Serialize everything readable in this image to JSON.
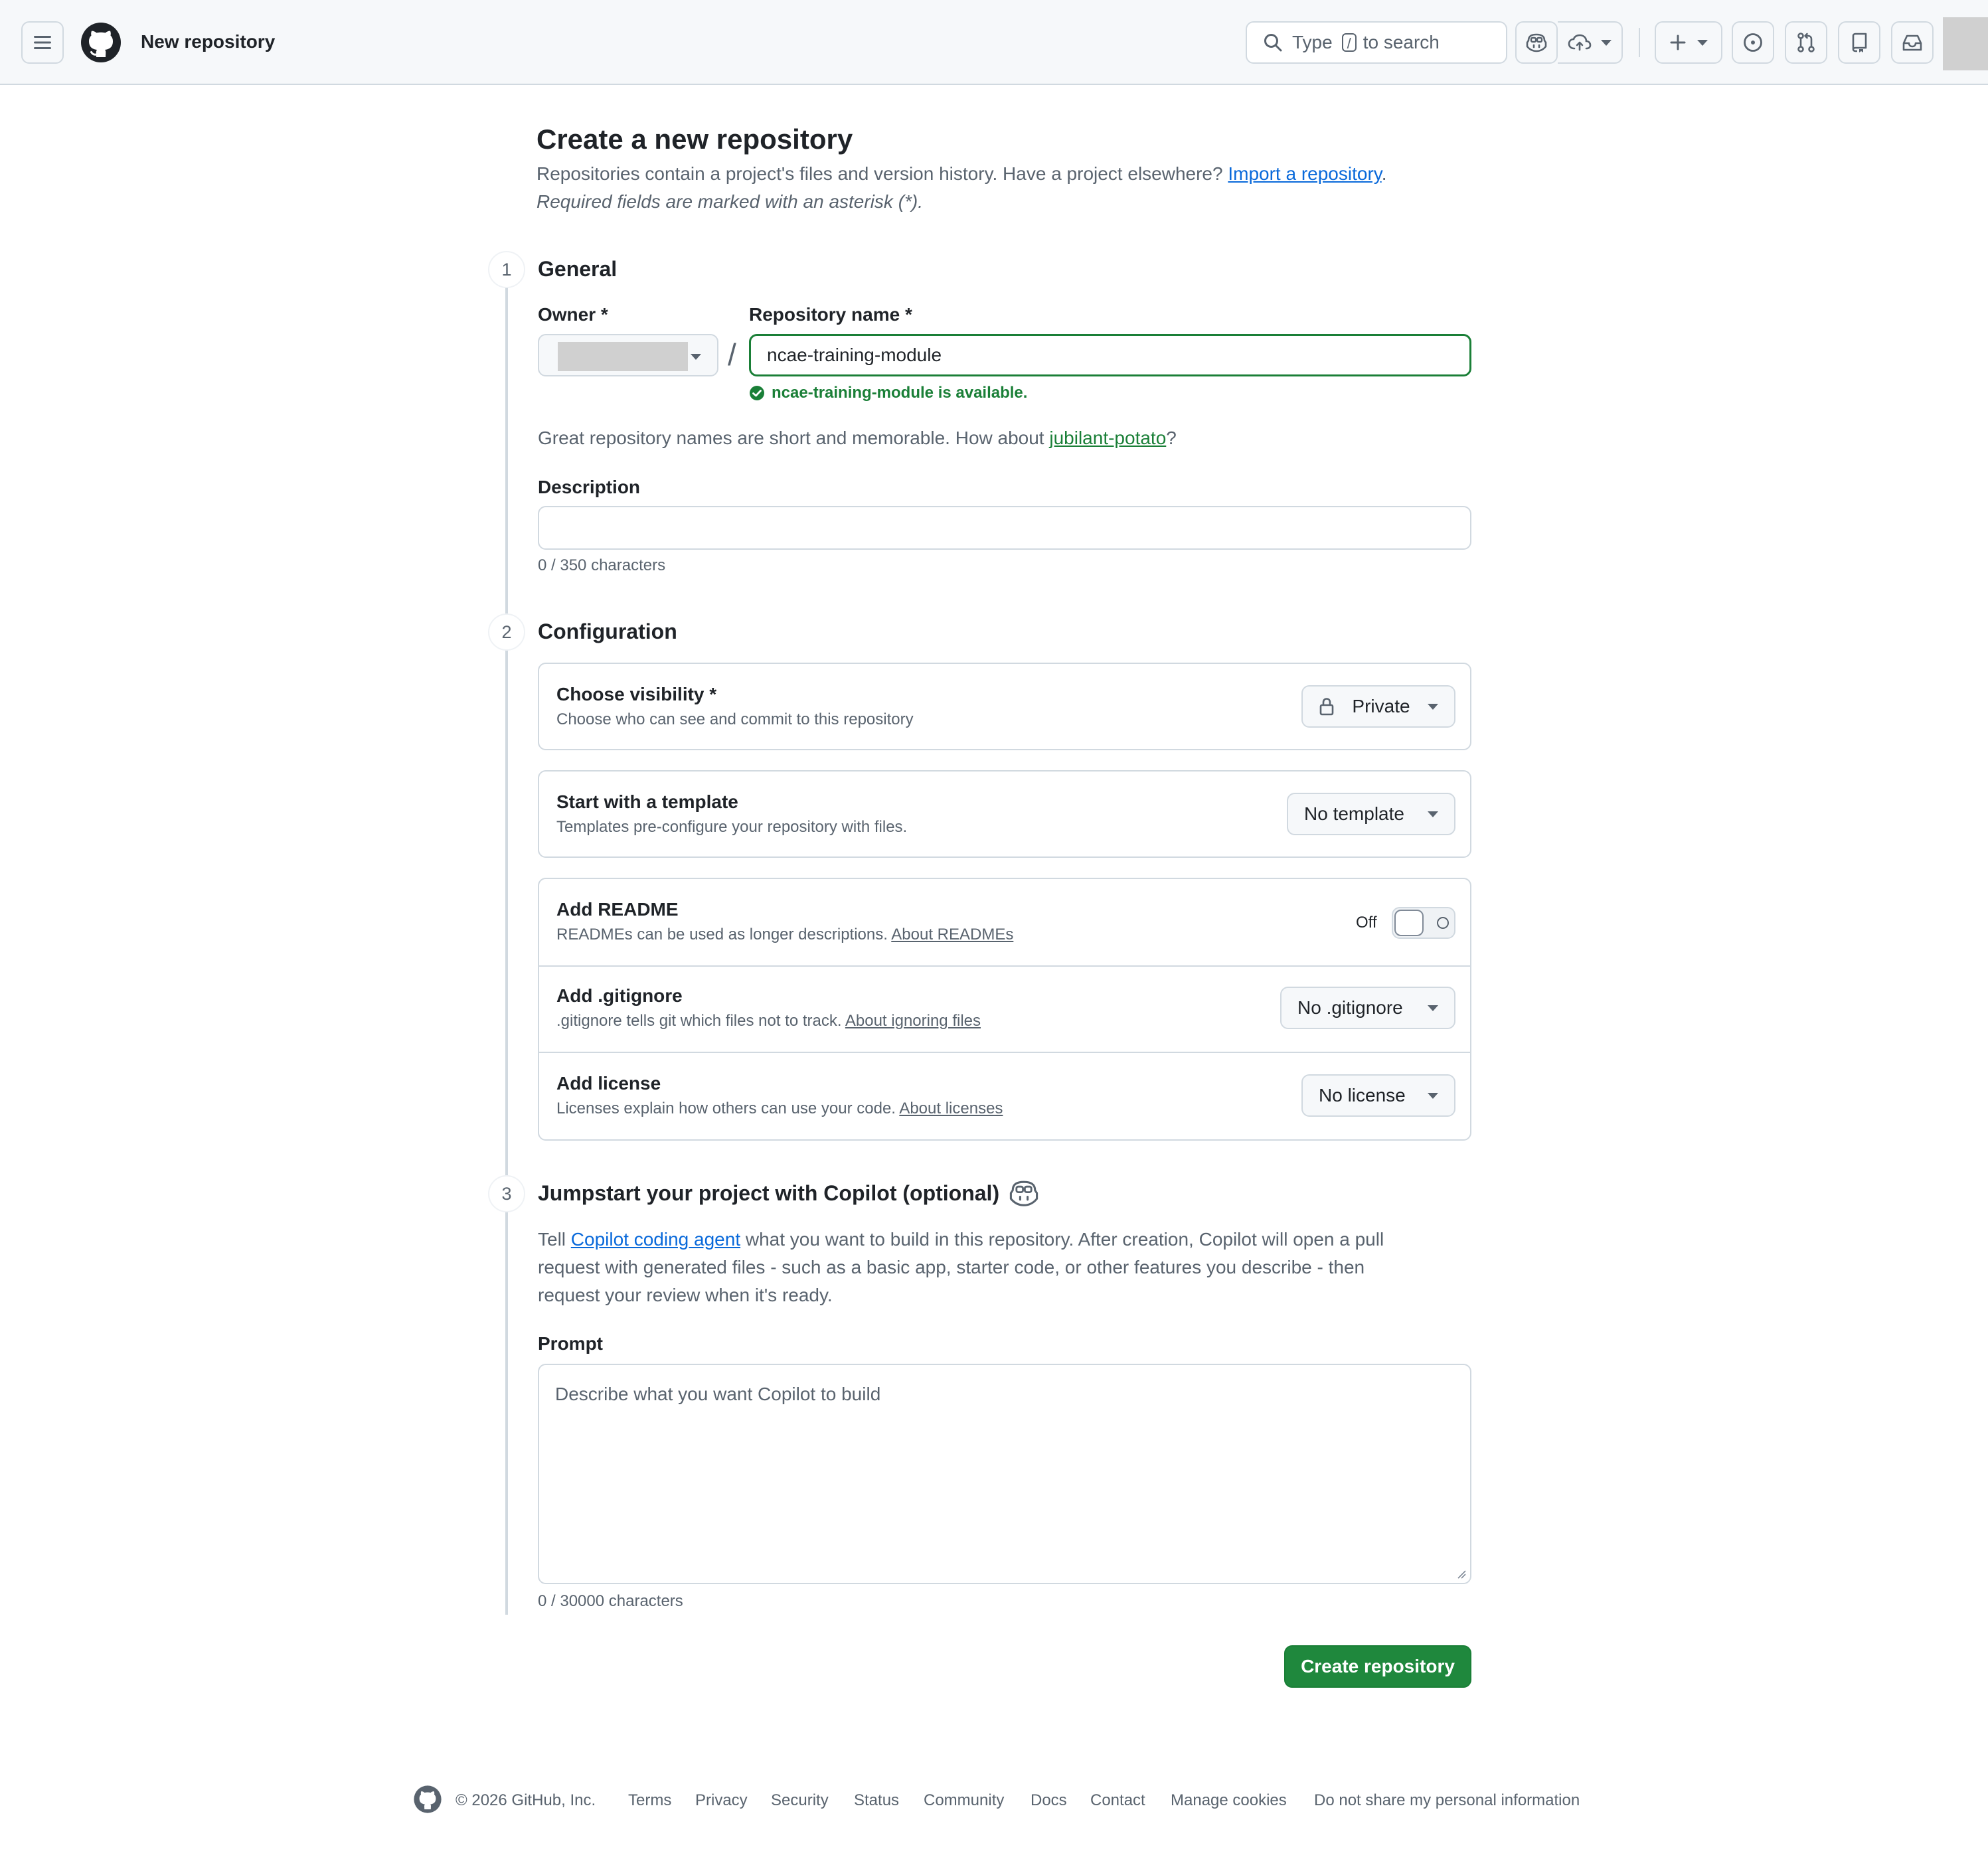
{
  "header": {
    "title": "New repository",
    "search": {
      "prefix": "Type",
      "key": "/",
      "suffix": "to search"
    }
  },
  "page": {
    "heading": "Create a new repository",
    "lead": "Repositories contain a project's files and version history. Have a project elsewhere?",
    "import_link": "Import a repository",
    "lead_end": ".",
    "required_note": "Required fields are marked with an asterisk (*)."
  },
  "general": {
    "step": "1",
    "title": "General",
    "owner_label": "Owner *",
    "slash": "/",
    "repo_label": "Repository name *",
    "repo_value": "ncae-training-module",
    "available_msg": "ncae-training-module is available.",
    "suggestion_prefix": "Great repository names are short and memorable. How about",
    "suggestion_link": "jubilant-potato",
    "suggestion_suffix": "?",
    "description_label": "Description",
    "description_value": "",
    "description_counter": "0 / 350 characters"
  },
  "configuration": {
    "step": "2",
    "title": "Configuration",
    "visibility": {
      "title": "Choose visibility *",
      "subtitle": "Choose who can see and commit to this repository",
      "value": "Private"
    },
    "template": {
      "title": "Start with a template",
      "subtitle": "Templates pre-configure your repository with files.",
      "value": "No template"
    },
    "readme": {
      "title": "Add README",
      "subtitle": "READMEs can be used as longer descriptions.",
      "link": "About READMEs",
      "state": "Off"
    },
    "gitignore": {
      "title": "Add .gitignore",
      "subtitle": ".gitignore tells git which files not to track.",
      "link": "About ignoring files",
      "value": "No .gitignore"
    },
    "license": {
      "title": "Add license",
      "subtitle": "Licenses explain how others can use your code.",
      "link": "About licenses",
      "value": "No license"
    }
  },
  "copilot": {
    "step": "3",
    "title": "Jumpstart your project with Copilot (optional)",
    "intro_prefix": "Tell",
    "intro_link": "Copilot coding agent",
    "intro_rest_1": "what you want to build in this repository. After creation, Copilot will open a pull",
    "intro_rest_2": "request with generated files - such as a basic app, starter code, or other features you describe - then",
    "intro_rest_3": "request your review when it's ready.",
    "prompt_label": "Prompt",
    "prompt_placeholder": "Describe what you want Copilot to build",
    "prompt_counter": "0 / 30000 characters"
  },
  "actions": {
    "create": "Create repository"
  },
  "footer": {
    "copyright": "© 2026 GitHub, Inc.",
    "links": [
      "Terms",
      "Privacy",
      "Security",
      "Status",
      "Community",
      "Docs",
      "Contact",
      "Manage cookies",
      "Do not share my personal information"
    ]
  },
  "colors": {
    "accent": "#0969da",
    "success": "#1a7f37",
    "primary_button": "#1f883d",
    "border": "#d1d9e0",
    "muted_text": "#59636e"
  }
}
